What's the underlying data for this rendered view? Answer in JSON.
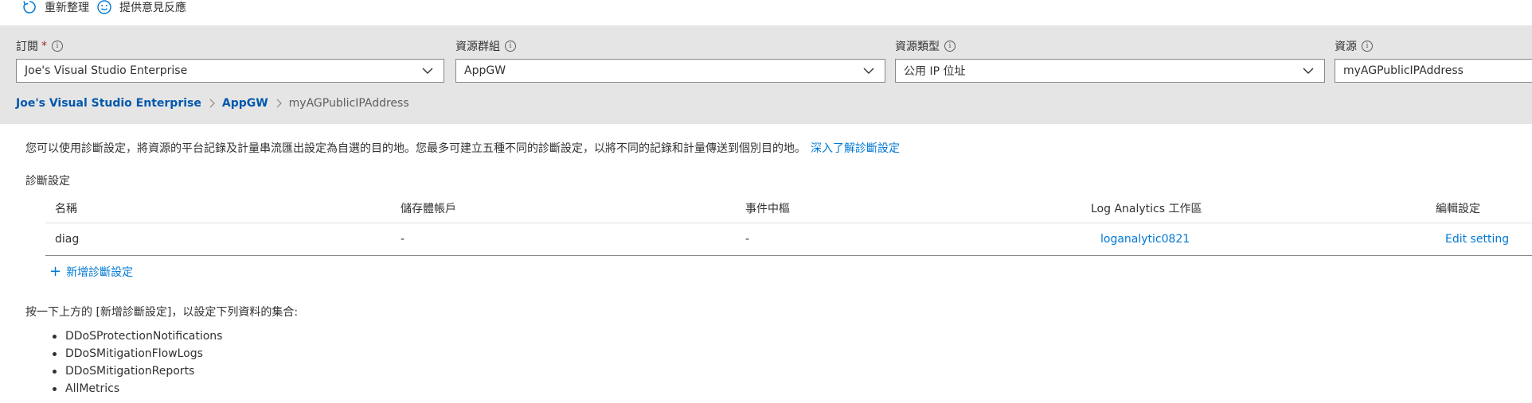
{
  "toolbar": {
    "refresh_label": "重新整理",
    "feedback_label": "提供意見反應"
  },
  "filters": {
    "subscription": {
      "label": "訂閱",
      "required_mark": "*",
      "value": "Joe's Visual Studio Enterprise"
    },
    "resource_group": {
      "label": "資源群組",
      "value": "AppGW"
    },
    "resource_type": {
      "label": "資源類型",
      "value": "公用 IP 位址"
    },
    "resource": {
      "label": "資源",
      "value": "myAGPublicIPAddress"
    },
    "info_glyph": "i"
  },
  "breadcrumb": {
    "items": [
      "Joe's Visual Studio Enterprise",
      "AppGW"
    ],
    "current": "myAGPublicIPAddress"
  },
  "description": {
    "text": "您可以使用診斷設定，將資源的平台記錄及計量串流匯出設定為自選的目的地。您最多可建立五種不同的診斷設定，以將不同的記錄和計量傳送到個別目的地。",
    "link": "深入了解診斷設定"
  },
  "diagnostic_settings": {
    "section_label": "診斷設定",
    "columns": [
      "名稱",
      "儲存體帳戶",
      "事件中樞",
      "Log Analytics 工作區",
      "編輯設定"
    ],
    "rows": [
      {
        "name": "diag",
        "storage": "-",
        "event_hub": "-",
        "workspace": "loganalytic0821",
        "edit": "Edit setting"
      }
    ],
    "add_label": "新增診斷設定",
    "add_glyph": "+"
  },
  "instructions": {
    "text": "按一下上方的 [新增診斷設定]，以設定下列資料的集合:",
    "items": [
      "DDoSProtectionNotifications",
      "DDoSMitigationFlowLogs",
      "DDoSMitigationReports",
      "AllMetrics"
    ]
  },
  "colors": {
    "accent": "#0078d4",
    "band": "#e5e5e5",
    "breadcrumb_link": "#0058ad",
    "required": "#a4262c"
  }
}
